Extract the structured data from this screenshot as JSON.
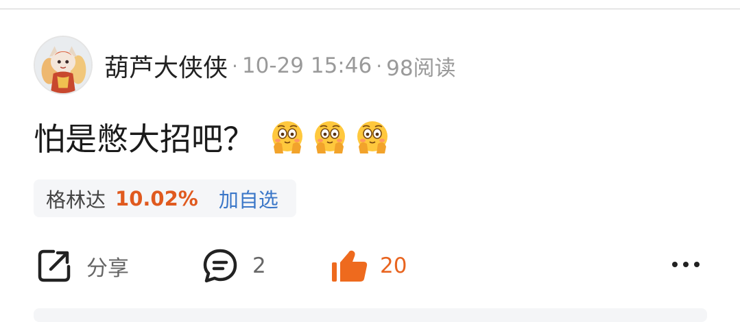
{
  "post": {
    "author": "葫芦大侠侠",
    "separator": "·",
    "timestamp": "10-29 15:46",
    "reads": "98阅读",
    "text": "怕是憋大招吧？"
  },
  "emoji": [
    "flushed-hands-emoji",
    "flushed-hands-emoji",
    "flushed-hands-emoji"
  ],
  "stock": {
    "name": "格林达",
    "change": "10.02%",
    "watch_label": "加自选"
  },
  "actions": {
    "share_label": "分享",
    "comment_count": "2",
    "like_count": "20"
  },
  "colors": {
    "up": "#e05a1f",
    "link": "#3b77c8",
    "like": "#e8641f"
  }
}
